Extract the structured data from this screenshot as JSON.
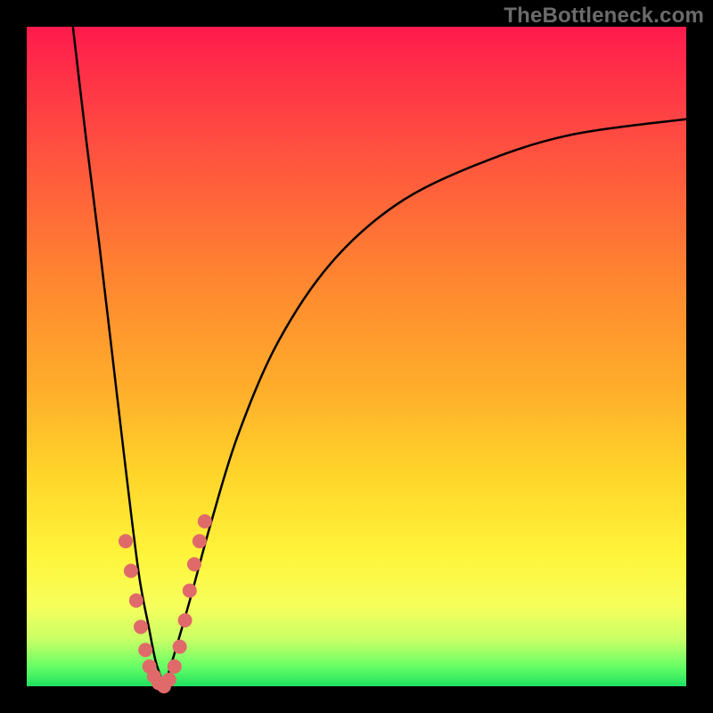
{
  "watermark": "TheBottleneck.com",
  "chart_data": {
    "type": "line",
    "title": "",
    "xlabel": "",
    "ylabel": "",
    "xlim": [
      0,
      100
    ],
    "ylim": [
      0,
      100
    ],
    "left_branch": {
      "name": "left",
      "x": [
        7,
        9,
        11,
        13,
        15,
        17,
        18.5,
        19.5,
        20.3,
        20.8
      ],
      "y": [
        100,
        83,
        67,
        50,
        33,
        17,
        9,
        4,
        1.5,
        0
      ]
    },
    "right_branch": {
      "name": "right",
      "x": [
        20.8,
        21.5,
        23,
        25,
        28,
        32,
        38,
        46,
        56,
        68,
        82,
        100
      ],
      "y": [
        0,
        2,
        7,
        14,
        25,
        38,
        52,
        64,
        73,
        79,
        83.5,
        86
      ]
    },
    "dots": {
      "name": "markers",
      "x": [
        15.0,
        15.8,
        16.6,
        17.3,
        18.0,
        18.6,
        19.3,
        20.0,
        20.8,
        21.6,
        22.4,
        23.2,
        24.0,
        24.7,
        25.4,
        26.2,
        27.0
      ],
      "y": [
        22.0,
        17.5,
        13.0,
        9.0,
        5.5,
        3.0,
        1.5,
        0.5,
        0.0,
        1.0,
        3.0,
        6.0,
        10.0,
        14.5,
        18.5,
        22.0,
        25.0
      ]
    },
    "colors": {
      "curve": "#000000",
      "dots": "#e06a6a",
      "gradient_top": "#ff1a4d",
      "gradient_bottom": "#20e060"
    }
  }
}
